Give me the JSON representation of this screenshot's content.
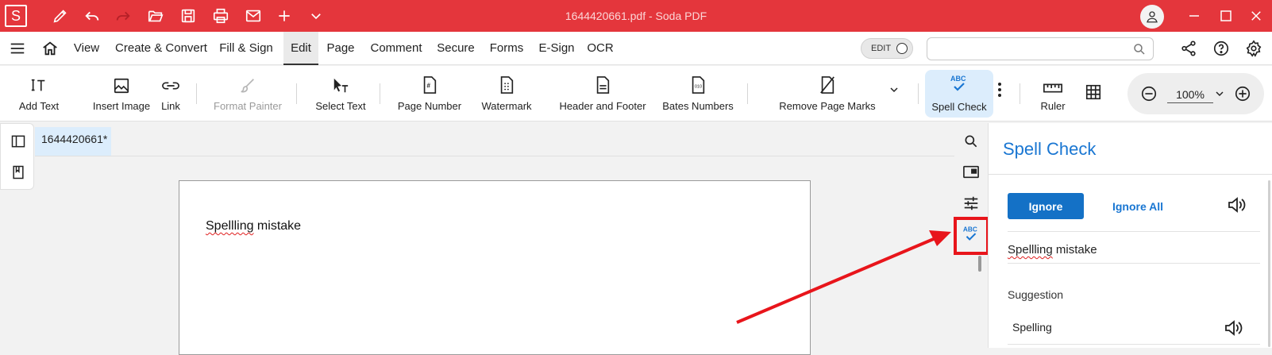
{
  "titlebar": {
    "app_logo": "S",
    "title": "1644420661.pdf  -  Soda PDF",
    "quick_icons": [
      "pen-icon",
      "undo-icon",
      "redo-icon",
      "open-folder-icon",
      "save-icon",
      "print-icon",
      "email-icon",
      "plus-icon",
      "chevron-down-icon"
    ],
    "window_buttons": [
      "minimize-icon",
      "maximize-icon",
      "close-icon"
    ]
  },
  "menubar": {
    "items": [
      {
        "label": "View"
      },
      {
        "label": "Create & Convert"
      },
      {
        "label": "Fill & Sign"
      },
      {
        "label": "Edit",
        "active": true
      },
      {
        "label": "Page"
      },
      {
        "label": "Comment"
      },
      {
        "label": "Secure"
      },
      {
        "label": "Forms"
      },
      {
        "label": "E-Sign"
      },
      {
        "label": "OCR"
      }
    ],
    "edit_toggle_label": "EDIT",
    "search_value": "",
    "search_placeholder": ""
  },
  "ribbon": {
    "tools": [
      {
        "label": "Add Text",
        "icon": "add-text-icon"
      },
      {
        "label": "Insert Image",
        "icon": "image-icon"
      },
      {
        "label": "Link",
        "icon": "link-icon"
      },
      {
        "label": "Format Painter",
        "icon": "brush-icon",
        "disabled": true
      },
      {
        "label": "Select Text",
        "icon": "select-text-icon"
      },
      {
        "label": "Page Number",
        "icon": "page-number-icon"
      },
      {
        "label": "Watermark",
        "icon": "watermark-icon"
      },
      {
        "label": "Header and Footer",
        "icon": "header-footer-icon"
      },
      {
        "label": "Bates Numbers",
        "icon": "bates-icon"
      },
      {
        "label": "Remove Page Marks",
        "icon": "remove-marks-icon"
      },
      {
        "label": "Spell Check",
        "icon": "spell-check-icon",
        "active": true
      },
      {
        "label": "Ruler",
        "icon": "ruler-icon"
      }
    ],
    "zoom": "100%"
  },
  "document": {
    "tab_label": "1644420661*",
    "text_misspelled": "Spellling",
    "text_rest": " mistake"
  },
  "spell_panel": {
    "title": "Spell Check",
    "ignore_label": "Ignore",
    "ignore_all_label": "Ignore All",
    "mistake_word": "Spellling",
    "mistake_rest": " mistake",
    "suggestion_heading": "Suggestion",
    "suggestions": [
      "Spelling"
    ]
  },
  "colors": {
    "titlebar": "#e4363c",
    "accent_blue": "#1471c6",
    "highlight_red": "#e8151b"
  }
}
